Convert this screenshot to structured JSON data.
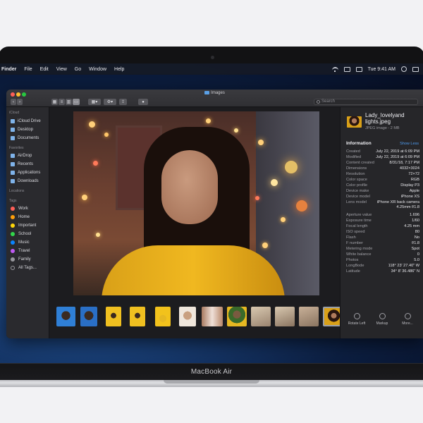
{
  "menubar": {
    "app": "Finder",
    "items": [
      "File",
      "Edit",
      "View",
      "Go",
      "Window",
      "Help"
    ],
    "clock": "Tue 9:41 AM"
  },
  "window": {
    "title": "Images"
  },
  "search": {
    "placeholder": "Search"
  },
  "sidebar": {
    "icloud_header": "iCloud",
    "icloud": [
      "iCloud Drive",
      "Desktop",
      "Documents"
    ],
    "favorites_header": "Favorites",
    "favorites": [
      "AirDrop",
      "Recents",
      "Applications",
      "Downloads"
    ],
    "locations_header": "Locations",
    "tags_header": "Tags",
    "tags": [
      {
        "label": "Work",
        "color": "#ff5f57"
      },
      {
        "label": "Home",
        "color": "#ff9f0a"
      },
      {
        "label": "Important",
        "color": "#ffd60a"
      },
      {
        "label": "School",
        "color": "#32d74b"
      },
      {
        "label": "Music",
        "color": "#0a84ff"
      },
      {
        "label": "Travel",
        "color": "#bf5af2"
      },
      {
        "label": "Family",
        "color": "#98989d"
      },
      {
        "label": "All Tags...",
        "color": ""
      }
    ]
  },
  "inspector": {
    "title": "Lady_lovelyand lights.jpeg",
    "subtitle": "JPEG image - 2 MB",
    "section": "Information",
    "show_less": "Show Less",
    "rows_top": [
      {
        "k": "Created",
        "v": "July 22, 2019 at 6:09 PM"
      },
      {
        "k": "Modified",
        "v": "July 22, 2019 at 6:09 PM"
      },
      {
        "k": "Content created",
        "v": "8/31/18, 7:17 PM"
      },
      {
        "k": "Dimensions",
        "v": "4032×3024"
      },
      {
        "k": "Resolution",
        "v": "72×72"
      },
      {
        "k": "Color space",
        "v": "RGB"
      },
      {
        "k": "Color profile",
        "v": "Display P3"
      },
      {
        "k": "Device make",
        "v": "Apple"
      },
      {
        "k": "Device model",
        "v": "iPhone XS"
      }
    ],
    "lens_k": "Lens model",
    "lens_v": "iPhone XR back camera 4.25mm f/1.8",
    "rows_bottom": [
      {
        "k": "Aperture value",
        "v": "1.696"
      },
      {
        "k": "Exposure time",
        "v": "1/60"
      },
      {
        "k": "Focal length",
        "v": "4.25 mm"
      },
      {
        "k": "ISO speed",
        "v": "80"
      },
      {
        "k": "Flash",
        "v": "No"
      },
      {
        "k": "F number",
        "v": "f/1.8"
      },
      {
        "k": "Metering mode",
        "v": "Spot"
      },
      {
        "k": "White balance",
        "v": "0"
      },
      {
        "k": "Photos",
        "v": "5.0"
      },
      {
        "k": "LongBode",
        "v": "118° 23' 27.40\" W"
      },
      {
        "k": "Latitude",
        "v": "34° 8' 36.486\" N"
      }
    ],
    "actions": [
      "Rotate Left",
      "Markup",
      "More..."
    ]
  },
  "device": {
    "label": "MacBook Air"
  }
}
